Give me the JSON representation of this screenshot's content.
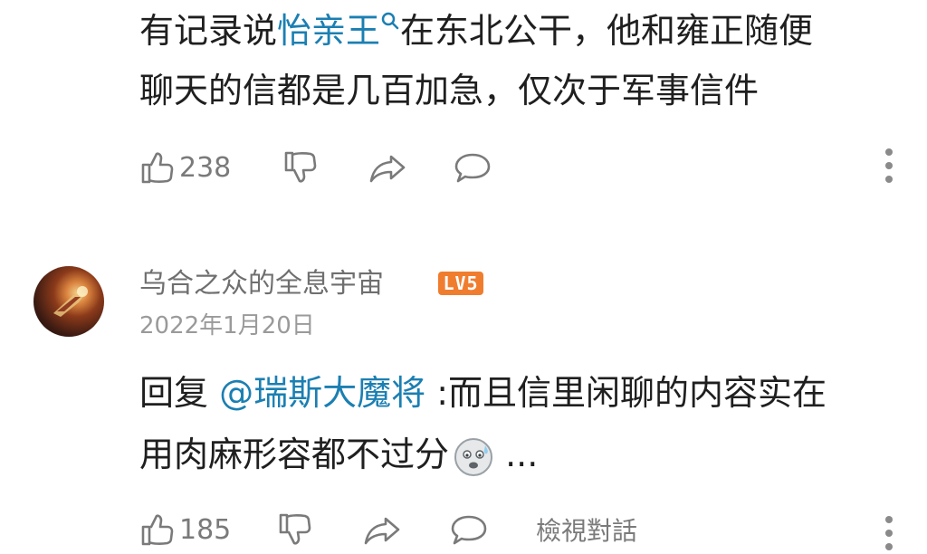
{
  "comment1": {
    "line1_before": "有记录说",
    "line1_link": "怡亲王",
    "line1_after": "在东北公干，他和雍正随便",
    "line2": "聊天的信都是几百加急，仅次于军事信件",
    "likes": "238"
  },
  "reply": {
    "username": "乌合之众的全息宇宙",
    "level": "LV5",
    "date": "2022年1月20日",
    "prefix": "回复 ",
    "mention": "@瑞斯大魔将",
    "line1_after": " :而且信里闲聊的内容实在",
    "line2": "用肉麻形容都不过分",
    "line2_suffix": " ...",
    "likes": "185",
    "view_thread": "檢視對話"
  },
  "icons": {
    "like": "thumbs-up-icon",
    "dislike": "thumbs-down-icon",
    "share": "share-icon",
    "reply": "comment-icon",
    "more": "more-vertical-icon",
    "search": "search-icon",
    "emoji": "sweat-emoji-icon"
  },
  "colors": {
    "link": "#1b7fb2",
    "level_badge": "#f07d2e",
    "icon": "#7a7a7a"
  }
}
